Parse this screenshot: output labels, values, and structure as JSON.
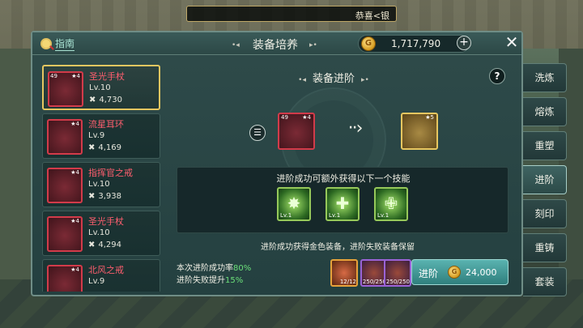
{
  "ticker": "恭喜<银",
  "header": {
    "guide": "指南",
    "title": "装备培养",
    "coin_symbol": "G",
    "coins": "1,717,790",
    "plus": "+",
    "close": "✕"
  },
  "items": [
    {
      "name": "圣光手杖",
      "lv": "Lv.10",
      "power": "4,730",
      "tag_lv": "49",
      "stars": "4"
    },
    {
      "name": "流星耳环",
      "lv": "Lv.9",
      "power": "4,169",
      "tag_lv": "",
      "stars": "4"
    },
    {
      "name": "指挥官之戒",
      "lv": "Lv.10",
      "power": "3,938",
      "tag_lv": "",
      "stars": "4"
    },
    {
      "name": "圣光手杖",
      "lv": "Lv.10",
      "power": "4,294",
      "tag_lv": "",
      "stars": "4"
    },
    {
      "name": "北风之戒",
      "lv": "Lv.9",
      "power": "",
      "tag_lv": "",
      "stars": "4"
    }
  ],
  "advance": {
    "title": "装备进阶",
    "help": "?",
    "menu": "☰",
    "from_lv": "49",
    "from_stars": "4",
    "to_stars": "5",
    "skill_caption": "进阶成功可额外获得以下一个技能",
    "skills": [
      {
        "lv": "Lv.1"
      },
      {
        "lv": "Lv.1"
      },
      {
        "lv": "Lv.1"
      }
    ],
    "note": "进阶成功获得金色装备，进阶失败装备保留",
    "rate_label": "本次进阶成功率",
    "rate_value": "80%",
    "fail_label": "进阶失败提升",
    "fail_value": "15%",
    "materials": [
      {
        "count": "12/12"
      },
      {
        "count": "250/250"
      },
      {
        "count": "250/250"
      }
    ],
    "button_label": "进阶",
    "cost": "24,000"
  },
  "tabs": [
    "洗炼",
    "熔炼",
    "重塑",
    "进阶",
    "刻印",
    "重铸",
    "套装"
  ],
  "active_tab": "进阶"
}
